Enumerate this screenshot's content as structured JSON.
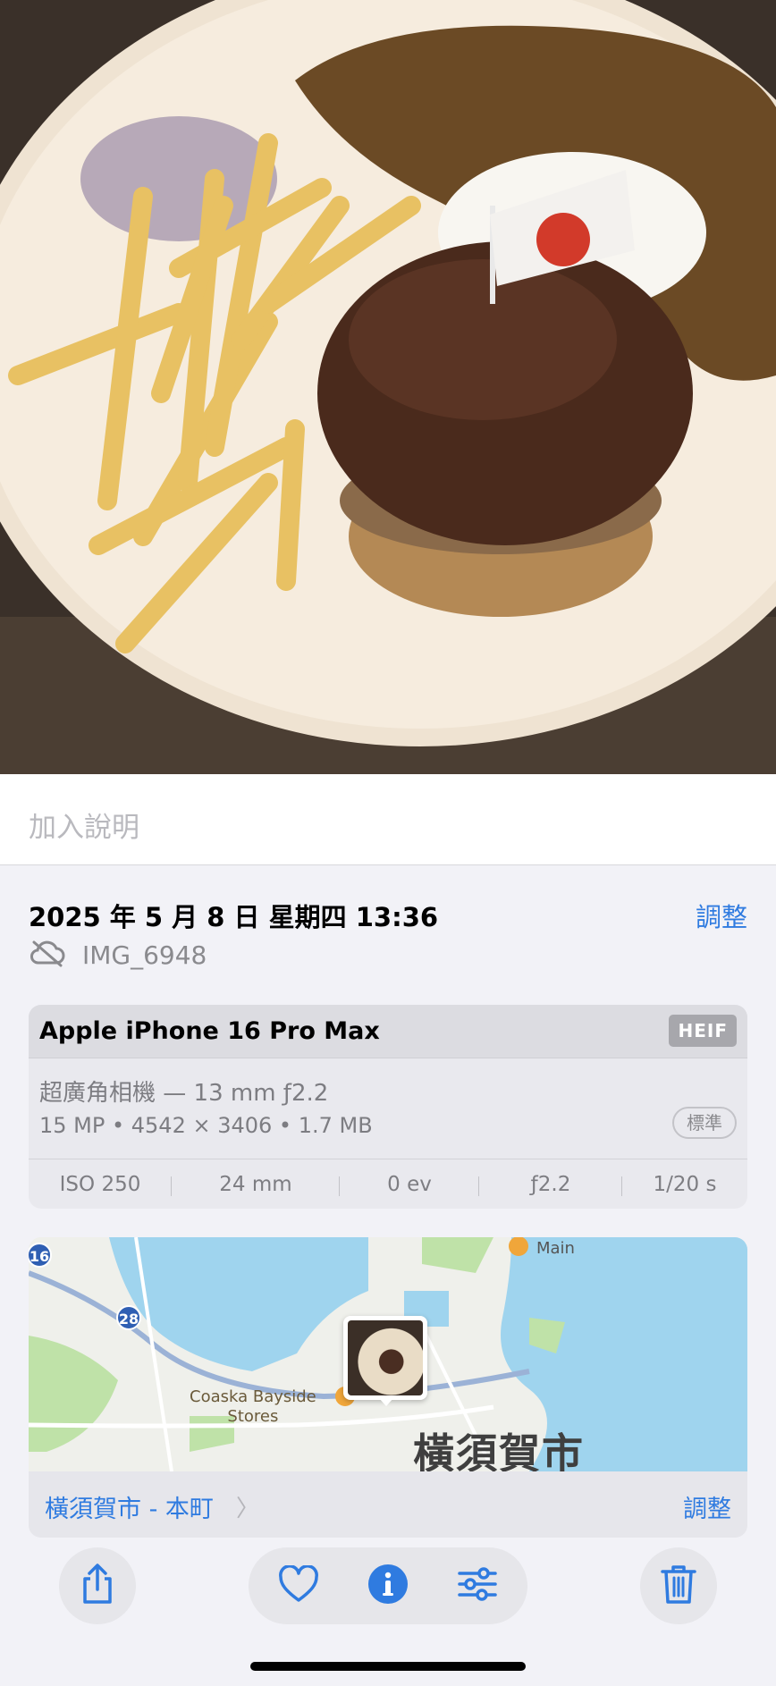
{
  "caption": {
    "placeholder": "加入說明"
  },
  "info": {
    "datetime": "2025 年 5 月 8 日 星期四 13:36",
    "adjust_label": "調整",
    "filename": "IMG_6948"
  },
  "camera": {
    "device": "Apple iPhone 16 Pro Max",
    "format_badge": "HEIF",
    "lens": "超廣角相機 — 13 mm ƒ2.2",
    "specs": "15 MP • 4542 × 3406 • 1.7 MB",
    "style_badge": "標準",
    "exif": [
      "ISO 250",
      "24 mm",
      "0 ev",
      "ƒ2.2",
      "1/20 s"
    ]
  },
  "map": {
    "poi_main": "Main",
    "poi_stores": "Coaska Bayside\nStores",
    "city_label": "橫須賀市",
    "route_16": "16",
    "route_28": "28",
    "place": "橫須賀市 - 本町",
    "adjust_label": "調整"
  },
  "toolbar": {
    "icons": [
      "share-icon",
      "heart-icon",
      "info-icon",
      "adjust-sliders-icon",
      "trash-icon"
    ],
    "accent_color": "#2f7be0"
  }
}
